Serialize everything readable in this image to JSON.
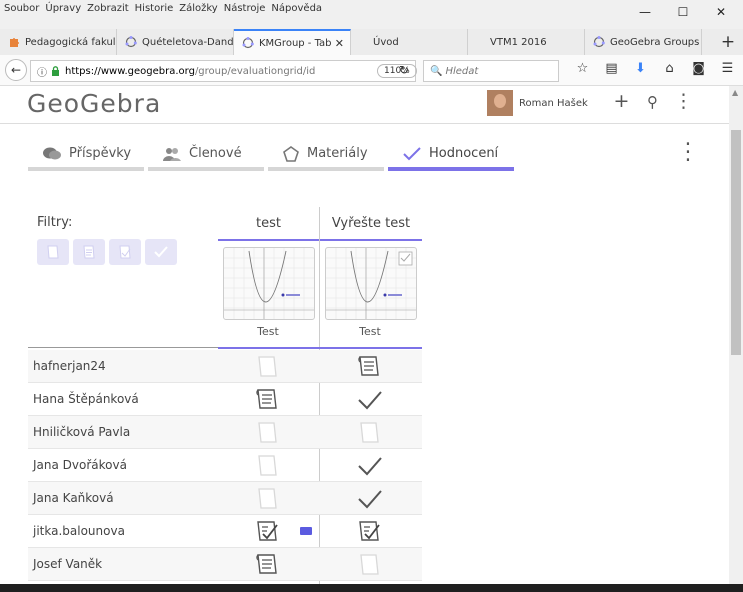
{
  "menu": [
    "Soubor",
    "Úpravy",
    "Zobrazit",
    "Historie",
    "Záložky",
    "Nástroje",
    "Nápověda"
  ],
  "window_controls": [
    "—",
    "☐",
    "✕"
  ],
  "tabs": [
    {
      "label": "Pedagogická fakul"
    },
    {
      "label": "Quételetova-Dand"
    },
    {
      "label": "KMGroup - Tab",
      "active": true
    },
    {
      "label": "Úvod"
    },
    {
      "label": "VTM1 2016"
    },
    {
      "label": "GeoGebra Groups"
    }
  ],
  "new_tab_label": "+",
  "navbar": {
    "url_host": "https://www.geogebra.org",
    "url_path": "/group/evaluationgrid/id",
    "zoom": "110%",
    "search_placeholder": "Hledat"
  },
  "header": {
    "logo": "GeoGebra",
    "user_name": "Roman Hašek"
  },
  "group_tabs": [
    {
      "label": "Příspěvky",
      "icon": "speech-bubbles-icon"
    },
    {
      "label": "Členové",
      "icon": "people-icon"
    },
    {
      "label": "Materiály",
      "icon": "shape-icon"
    },
    {
      "label": "Hodnocení",
      "icon": "check-icon",
      "active": true
    }
  ],
  "grid": {
    "filters_label": "Filtry:",
    "columns": [
      {
        "title": "test",
        "thumb_label": "Test"
      },
      {
        "title": "Vyřešte test",
        "thumb_label": "Test"
      }
    ],
    "rows": [
      {
        "name": "hafnerjan24",
        "cells": [
          "empty",
          "submitted"
        ]
      },
      {
        "name": "Hana Štěpánková",
        "cells": [
          "submitted",
          "check"
        ]
      },
      {
        "name": "Hniličková Pavla",
        "cells": [
          "empty",
          "empty"
        ]
      },
      {
        "name": "Jana Dvořáková",
        "cells": [
          "empty",
          "check"
        ]
      },
      {
        "name": "Jana Kaňková",
        "cells": [
          "empty",
          "check"
        ]
      },
      {
        "name": "jitka.balounova",
        "cells": [
          "graded",
          "graded"
        ],
        "comment": true
      },
      {
        "name": "Josef Vaněk",
        "cells": [
          "submitted",
          "empty"
        ]
      }
    ]
  },
  "colors": {
    "accent": "#7c72e8",
    "filter_bg": "#e6e5f7"
  }
}
